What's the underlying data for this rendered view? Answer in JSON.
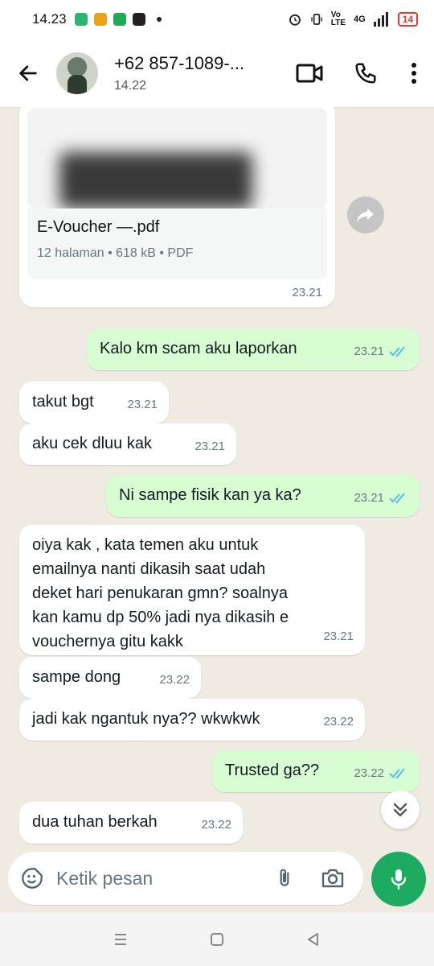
{
  "status_bar": {
    "time": "14.23",
    "battery": "14",
    "network": "4G"
  },
  "header": {
    "contact_name": "+62 857-1089-...",
    "contact_status": "14.22"
  },
  "document": {
    "filename": "E-Voucher —.pdf",
    "details": "12 halaman • 618 kB • PDF",
    "time": "23.21"
  },
  "messages": [
    {
      "dir": "out",
      "text": "Kalo km scam aku laporkan",
      "time": "23.21"
    },
    {
      "dir": "in",
      "text": "takut bgt",
      "time": "23.21"
    },
    {
      "dir": "in",
      "text": "aku cek dluu kak",
      "time": "23.21"
    },
    {
      "dir": "out",
      "text": "Ni sampe fisik kan ya ka?",
      "time": "23.21"
    },
    {
      "dir": "in",
      "lines": [
        "oiya kak , kata temen aku untuk",
        "emailnya nanti dikasih saat udah",
        "deket hari penukaran gmn? soalnya",
        "kan kamu dp 50% jadi nya dikasih e",
        "vouchernya gitu kakk"
      ],
      "time": "23.21"
    },
    {
      "dir": "in",
      "text": "sampe dong",
      "time": "23.22"
    },
    {
      "dir": "in",
      "text": "jadi kak ngantuk nya?? wkwkwk",
      "time": "23.22"
    },
    {
      "dir": "out",
      "text": "Trusted ga??",
      "time": "23.22"
    },
    {
      "dir": "in",
      "text": "dua tuhan berkah",
      "time": "23.22"
    }
  ],
  "input": {
    "placeholder": "Ketik pesan"
  },
  "colors": {
    "outgoing_bubble": "#d9fdd3",
    "incoming_bubble": "#ffffff",
    "accent_green": "#1daa61",
    "read_ticks": "#53bdeb",
    "chat_background": "#efeae2"
  },
  "icons": [
    "back-arrow-icon",
    "video-call-icon",
    "phone-icon",
    "more-vert-icon",
    "forward-icon",
    "double-chevron-down-icon",
    "sticker-icon",
    "attach-icon",
    "camera-icon",
    "mic-icon"
  ]
}
